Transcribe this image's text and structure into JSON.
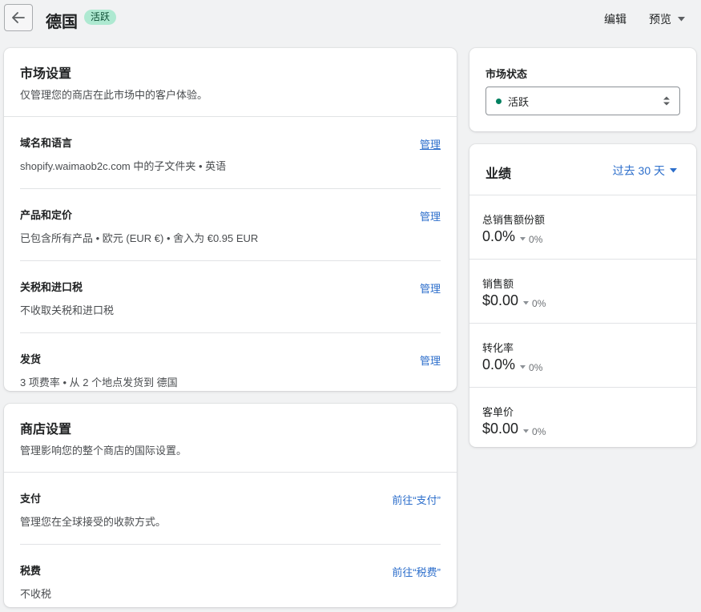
{
  "header": {
    "title": "德国",
    "badge": "活跃",
    "edit_label": "编辑",
    "preview_label": "预览"
  },
  "market_settings": {
    "title": "市场设置",
    "subtitle": "仅管理您的商店在此市场中的客户体验。",
    "sections": [
      {
        "title": "域名和语言",
        "desc": "shopify.waimaob2c.com 中的子文件夹 • 英语",
        "link": "管理"
      },
      {
        "title": "产品和定价",
        "desc": "已包含所有产品 • 欧元 (EUR €) • 舍入为 €0.95 EUR",
        "link": "管理"
      },
      {
        "title": "关税和进口税",
        "desc": "不收取关税和进口税",
        "link": "管理"
      },
      {
        "title": "发货",
        "desc": "3 项费率 • 从 2 个地点发货到 德国",
        "link": "管理"
      }
    ]
  },
  "store_settings": {
    "title": "商店设置",
    "subtitle": "管理影响您的整个商店的国际设置。",
    "sections": [
      {
        "title": "支付",
        "desc": "管理您在全球接受的收款方式。",
        "link": "前往“支付”"
      },
      {
        "title": "税费",
        "desc": "不收税",
        "link": "前往“税费”"
      }
    ]
  },
  "market_status": {
    "title": "市场状态",
    "selected": "活跃",
    "status_color": "#008060"
  },
  "performance": {
    "title": "业绩",
    "range": "过去 30 天",
    "metrics": [
      {
        "label": "总销售额份额",
        "value": "0.0%",
        "delta": "0%",
        "sparkline": true
      },
      {
        "label": "销售额",
        "value": "$0.00",
        "delta": "0%",
        "sparkline": true
      },
      {
        "label": "转化率",
        "value": "0.0%",
        "delta": "0%",
        "sparkline": false
      },
      {
        "label": "客单价",
        "value": "$0.00",
        "delta": "0%",
        "sparkline": false
      }
    ]
  },
  "colors": {
    "accent": "#2c6ecb",
    "badge_bg": "#aee9d1",
    "page_bg": "#f1f2f3"
  }
}
